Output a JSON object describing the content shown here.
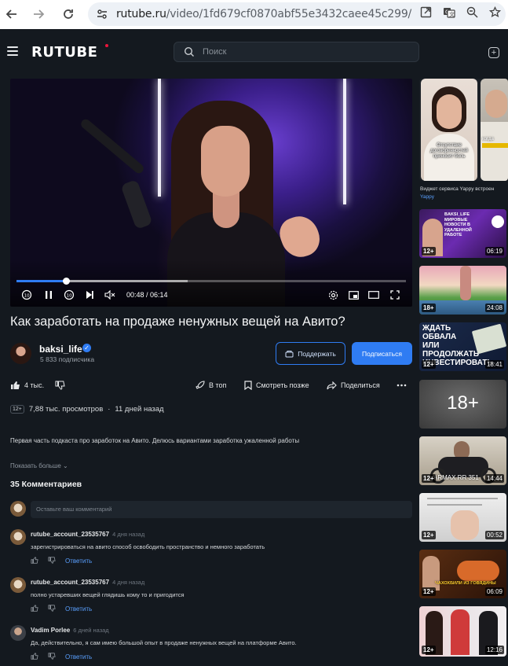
{
  "browser": {
    "url_host": "rutube.ru",
    "url_path": "/video/1fd679cf0870abf55e3432caee45c299/"
  },
  "header": {
    "logo": "RUTUBE",
    "search_placeholder": "Поиск"
  },
  "player": {
    "current_time": "00:48",
    "duration": "06:14",
    "time_display": "00:48 / 06:14",
    "progress_fraction": 0.128,
    "buffer_fraction": 0.44
  },
  "video": {
    "title": "Как заработать на продаже ненужных вещей на Авито?",
    "channel_name": "baksi_life",
    "subscribers": "5 833 подписчика",
    "support_label": "Поддержать",
    "subscribe_label": "Подписаться",
    "likes": "4 тыс.",
    "top_label": "В топ",
    "watch_later_label": "Смотреть позже",
    "share_label": "Поделиться",
    "age_rating": "12+",
    "views": "7,88 тыс. просмотров",
    "posted": "11 дней назад",
    "description": "Первая часть подкаста про заработок на Авито. Делюсь вариантами заработка ужаленной работы",
    "show_more": "Показать больше"
  },
  "comments": {
    "count_label": "35 Комментариев",
    "input_placeholder": "Оставьте ваш комментарий",
    "reply_label": "Ответить",
    "items": [
      {
        "author": "rutube_account_23535767",
        "ago": "4 дня назад",
        "text": "зарегистрироваться на авито способ освободить пространство и немного заработать"
      },
      {
        "author": "rutube_account_23535767",
        "ago": "4 дня назад",
        "text": "полно устаревших вещей глядишь кому то и пригодится"
      },
      {
        "author": "Vadim Porlee",
        "ago": "6 дней назад",
        "text": "Да, действительно, я сам имею большой опыт в продаже ненужных вещей на платформе Авито."
      }
    ]
  },
  "sidebar": {
    "yappy_title": "Виджет сервиса Yappy встроен",
    "yappy_sub": "Yappy",
    "yappy_caption_1": "Отсутствие договоренностей приносит боль",
    "yappy_caption_2": "когда",
    "cards": [
      {
        "age": "12+",
        "duration": "06:19",
        "overlay": "BAKSI_LIFE МИРОВЫЕ НОВОСТИ В УДАЛЕННОЙ РАБОТЕ"
      },
      {
        "age": "18+",
        "duration": "24:08",
        "overlay": ""
      },
      {
        "age": "12+",
        "duration": "18:41",
        "overlay": "ЖДАТЬ ОБВАЛА ИЛИ ПРОДОЛЖАТЬ ИНВЕСТИРОВАТЬ"
      },
      {
        "age": "",
        "duration": "",
        "overlay": "18+"
      },
      {
        "age": "12+",
        "duration": "14:44",
        "overlay": "ARMAX RR 351"
      },
      {
        "age": "12+",
        "duration": "00:52",
        "overlay": ""
      },
      {
        "age": "12+",
        "duration": "06:09",
        "overlay": "ЧАХОХБИЛИ ИЗ ГОВЯДИНЫ"
      },
      {
        "age": "12+",
        "duration": "12:16",
        "overlay": ""
      }
    ]
  },
  "colors": {
    "accent": "#2f7cf3",
    "background": "#14191f",
    "logo_dot": "#ed143b"
  }
}
